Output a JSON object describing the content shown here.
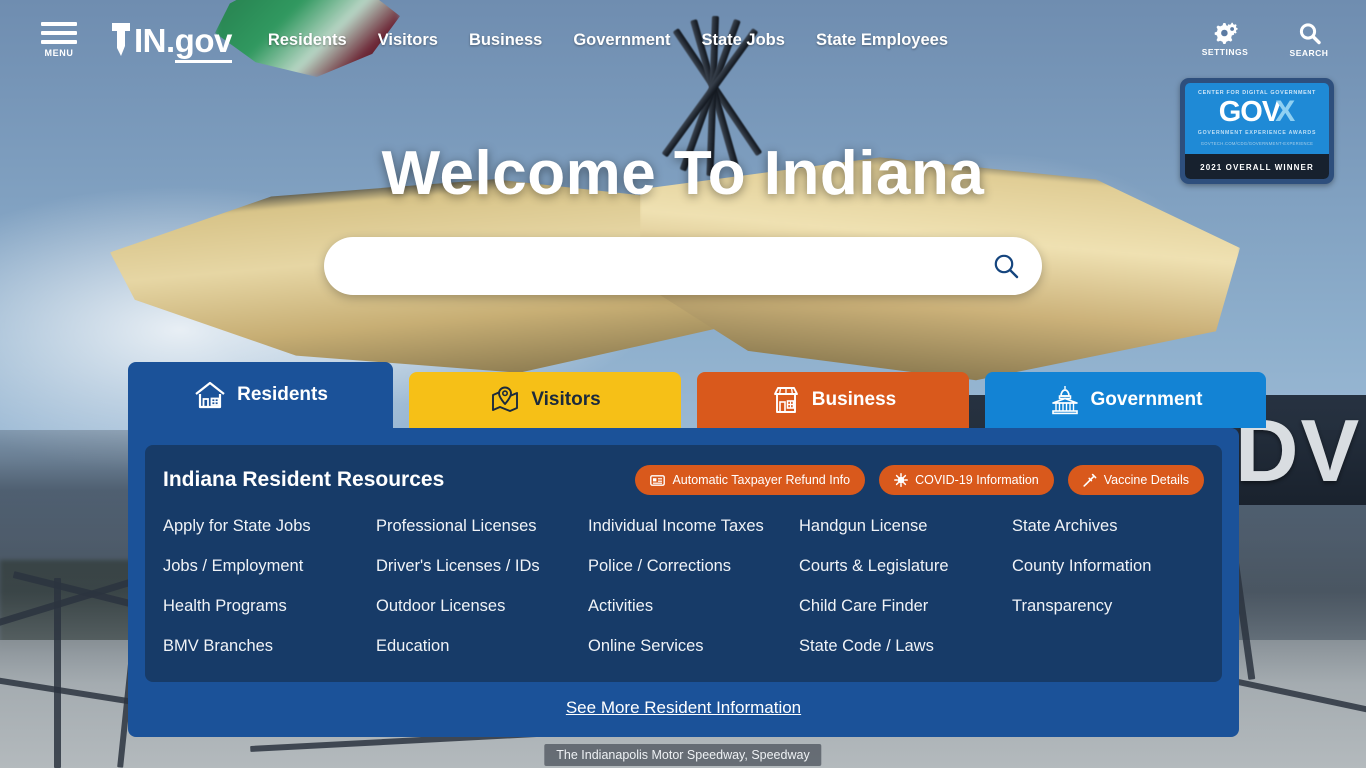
{
  "header": {
    "menu_label": "MENU",
    "menu_icon": "hamburger-icon",
    "logo_in": "IN",
    "logo_dot": ".",
    "logo_gov": "gov",
    "nav": [
      {
        "label": "Residents"
      },
      {
        "label": "Visitors"
      },
      {
        "label": "Business"
      },
      {
        "label": "Government"
      },
      {
        "label": "State Jobs"
      },
      {
        "label": "State Employees"
      }
    ],
    "settings_label": "SETTINGS",
    "settings_icon": "gears-icon",
    "search_label": "SEARCH",
    "search_icon": "magnifier-icon"
  },
  "award": {
    "top_text": "CENTER FOR DIGITAL GOVERNMENT",
    "gov": "GOV",
    "x": "X",
    "subtitle": "GOVERNMENT EXPERIENCE AWARDS",
    "url": "GOVTECH.COM/CDG/GOVERNMENT-EXPERIENCE",
    "winner": "2021 OVERALL WINNER"
  },
  "hero": {
    "title": "Welcome To Indiana",
    "search_value": "",
    "search_placeholder": "",
    "search_icon": "magnifier-icon"
  },
  "tabs": [
    {
      "label": "Residents",
      "icon": "house-icon",
      "active": true,
      "color": "#1b5299"
    },
    {
      "label": "Visitors",
      "icon": "map-pin-icon",
      "active": false,
      "color": "#f6c017"
    },
    {
      "label": "Business",
      "icon": "storefront-icon",
      "active": false,
      "color": "#d9591c"
    },
    {
      "label": "Government",
      "icon": "capitol-icon",
      "active": false,
      "color": "#1383d4"
    }
  ],
  "panel": {
    "title": "Indiana Resident Resources",
    "pills": [
      {
        "label": "Automatic Taxpayer Refund Info",
        "icon": "id-card-icon"
      },
      {
        "label": "COVID-19 Information",
        "icon": "virus-icon"
      },
      {
        "label": "Vaccine Details",
        "icon": "syringe-icon"
      }
    ],
    "columns": [
      [
        "Apply for State Jobs",
        "Jobs / Employment",
        "Health Programs",
        "BMV Branches"
      ],
      [
        "Professional Licenses",
        "Driver's Licenses / IDs",
        "Outdoor Licenses",
        "Education"
      ],
      [
        "Individual Income Taxes",
        "Police / Corrections",
        "Activities",
        "Online Services"
      ],
      [
        "Handgun License",
        "Courts & Legislature",
        "Child Care Finder",
        "State Code / Laws"
      ],
      [
        "State Archives",
        "County Information",
        "Transparency"
      ]
    ],
    "see_more": "See More Resident Information"
  },
  "caption": "The Indianapolis Motor Speedway, Speedway",
  "colors": {
    "panel_outer": "#1b5299",
    "panel_inner": "#173b68",
    "accent_orange": "#d9591c",
    "accent_yellow": "#f6c017",
    "accent_blue": "#1383d4"
  }
}
